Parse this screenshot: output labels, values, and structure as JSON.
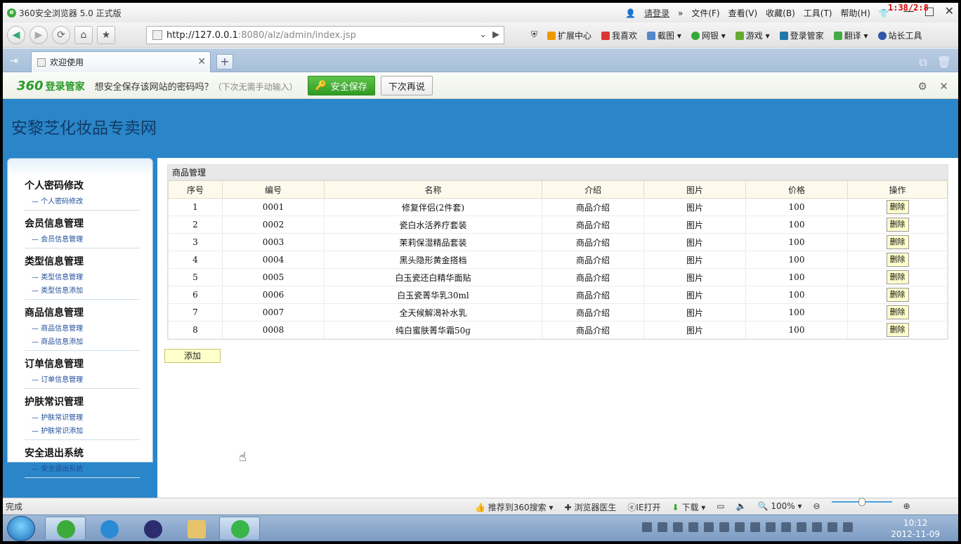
{
  "browser": {
    "title": "360安全浏览器 5.0 正式版",
    "login": "请登录",
    "menus": [
      "文件(F)",
      "查看(V)",
      "收藏(B)",
      "工具(T)",
      "帮助(H)"
    ],
    "clock_overlay": "1:38/2:8"
  },
  "nav": {
    "url_host": "http://127.0.0.1",
    "url_rest": ":8080/alz/admin/index.jsp",
    "tools": [
      "扩展中心",
      "我喜欢",
      "截图",
      "网银",
      "游戏",
      "登录管家",
      "翻译",
      "站长工具"
    ]
  },
  "tab": {
    "title": "欢迎使用"
  },
  "pw": {
    "brand_num": "360",
    "brand": "登录管家",
    "question": "想安全保存该网站的密码吗？",
    "hint": "（下次无需手动输入）",
    "save": "安全保存",
    "later": "下次再说"
  },
  "site": {
    "title": "安黎芝化妆品专卖网"
  },
  "sidebar": [
    {
      "title": "个人密码修改",
      "items": [
        "个人密码修改"
      ]
    },
    {
      "title": "会员信息管理",
      "items": [
        "会员信息管理"
      ]
    },
    {
      "title": "类型信息管理",
      "items": [
        "类型信息管理",
        "类型信息添加"
      ]
    },
    {
      "title": "商品信息管理",
      "items": [
        "商品信息管理",
        "商品信息添加"
      ]
    },
    {
      "title": "订单信息管理",
      "items": [
        "订单信息管理"
      ]
    },
    {
      "title": "护肤常识管理",
      "items": [
        "护肤常识管理",
        "护肤常识添加"
      ]
    },
    {
      "title": "安全退出系统",
      "items": [
        "安全退出系统"
      ]
    }
  ],
  "panel": {
    "title": "商品管理",
    "add": "添加",
    "delete": "删除",
    "columns": [
      "序号",
      "编号",
      "名称",
      "介绍",
      "图片",
      "价格",
      "操作"
    ],
    "rows": [
      [
        "1",
        "0001",
        "修复伴侣(2件套)",
        "商品介绍",
        "图片",
        "100"
      ],
      [
        "2",
        "0002",
        "瓷白水活养疗套装",
        "商品介绍",
        "图片",
        "100"
      ],
      [
        "3",
        "0003",
        "茉莉保湿精品套装",
        "商品介绍",
        "图片",
        "100"
      ],
      [
        "4",
        "0004",
        "黑头隐形黄金搭档",
        "商品介绍",
        "图片",
        "100"
      ],
      [
        "5",
        "0005",
        "白玉瓷还白精华面贴",
        "商品介绍",
        "图片",
        "100"
      ],
      [
        "6",
        "0006",
        "白玉瓷菁华乳30ml",
        "商品介绍",
        "图片",
        "100"
      ],
      [
        "7",
        "0007",
        "全天候解渴补水乳",
        "商品介绍",
        "图片",
        "100"
      ],
      [
        "8",
        "0008",
        "纯白蜜肤菁华霜50g",
        "商品介绍",
        "图片",
        "100"
      ]
    ]
  },
  "status": {
    "left": "完成",
    "items": [
      "推荐到360搜索",
      "浏览器医生",
      "IE打开",
      "下载",
      "100%"
    ]
  },
  "taskbar": {
    "time": "10:12",
    "date": "2012-11-09"
  },
  "colors": {
    "header_blue": "#2a86c8",
    "save_green": "#3aa52c"
  }
}
